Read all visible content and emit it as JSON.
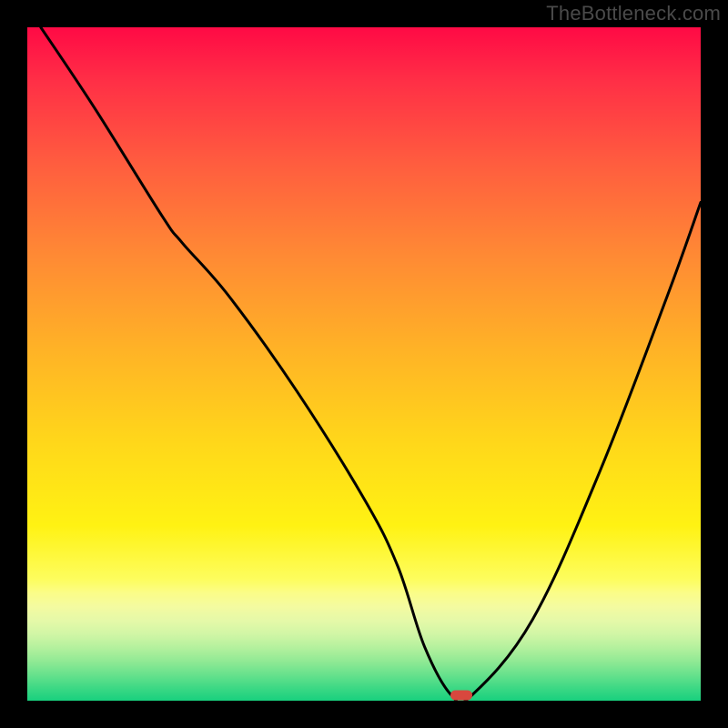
{
  "watermark": "TheBottleneck.com",
  "chart_data": {
    "type": "line",
    "title": "",
    "xlabel": "",
    "ylabel": "",
    "xlim": [
      0,
      100
    ],
    "ylim": [
      0,
      100
    ],
    "grid": false,
    "curve": {
      "name": "bottleneck-curve",
      "x": [
        2,
        10,
        20,
        23,
        30,
        40,
        50,
        55,
        59,
        63,
        66,
        75,
        85,
        95,
        100
      ],
      "y": [
        100,
        88,
        72,
        68,
        60,
        46,
        30,
        20,
        8,
        0.8,
        0.8,
        12,
        34,
        60,
        74
      ]
    },
    "marker": {
      "x": 64.5,
      "y": 0.8,
      "color": "#d8483e"
    },
    "background_gradient": {
      "top": "#ff0a45",
      "mid": "#ffe014",
      "bottom": "#18d07e"
    }
  }
}
